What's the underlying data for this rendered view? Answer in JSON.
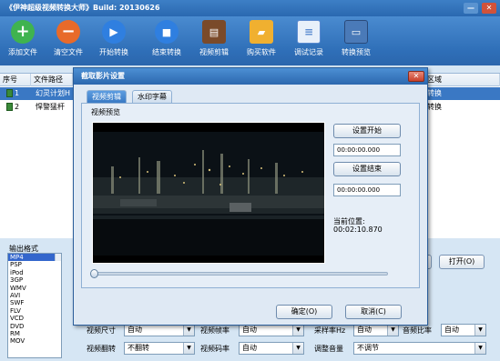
{
  "window": {
    "title": "《伊神超级视频转换大师》Build: 20130626",
    "minimize_label": "—",
    "close_label": "✕"
  },
  "toolbar": {
    "items": [
      {
        "label": "添加文件",
        "icon": "add-icon",
        "color": "#3fb34f"
      },
      {
        "label": "清空文件",
        "icon": "minus-icon",
        "color": "#e86a2a"
      },
      {
        "label": "开始转换",
        "icon": "play-icon",
        "color": "#2f7fe0"
      },
      {
        "label": "结束转换",
        "icon": "stop-icon",
        "color": "#2f7fe0"
      },
      {
        "label": "视频剪辑",
        "icon": "film-icon",
        "color": "#7a4a2a"
      },
      {
        "label": "购买软件",
        "icon": "folder-icon",
        "color": "#f0b030"
      },
      {
        "label": "调试记录",
        "icon": "document-icon",
        "color": "#5a8ad0"
      },
      {
        "label": "转换预览",
        "icon": "monitor-icon",
        "color": "#4a7ab8"
      }
    ]
  },
  "filelist": {
    "headers": [
      "序号",
      "文件路径",
      "区域"
    ],
    "rows": [
      {
        "index": "1",
        "path": "幻灵计划H",
        "area": "转换"
      },
      {
        "index": "2",
        "path": "悍警猛杆",
        "area": "转换"
      }
    ]
  },
  "output": {
    "label": "输出格式",
    "formats": [
      "MP4",
      "PSP",
      "iPod",
      "3GP",
      "WMV",
      "AVI",
      "SWF",
      "FLV",
      "VCD",
      "DVD",
      "RM",
      "MOV"
    ],
    "selected": "MP4",
    "open_button": "打开(O)",
    "settings": [
      {
        "label": "视频尺寸",
        "value": "自动"
      },
      {
        "label": "视频帧率",
        "value": "自动"
      },
      {
        "label": "采样率Hz",
        "value": "自动"
      },
      {
        "label": "音频比率",
        "value": "自动"
      },
      {
        "label": "视频翻转",
        "value": "不翻转"
      },
      {
        "label": "视频码率",
        "value": "自动"
      },
      {
        "label": "调整音量",
        "value": "不调节"
      }
    ]
  },
  "dialog": {
    "title": "截取影片设置",
    "close_label": "✕",
    "tabs": [
      "视频剪辑",
      "水印字幕"
    ],
    "active_tab": "视频剪辑",
    "group_label": "视频预览",
    "set_start": "设置开始",
    "start_time": "00:00:00.000",
    "set_end": "设置结束",
    "end_time": "00:00:00.000",
    "position_label": "当前位置:",
    "position_value": "00:02:10.870",
    "playback_progress": 0.0,
    "ok": "确定(O)",
    "cancel": "取消(C)"
  }
}
